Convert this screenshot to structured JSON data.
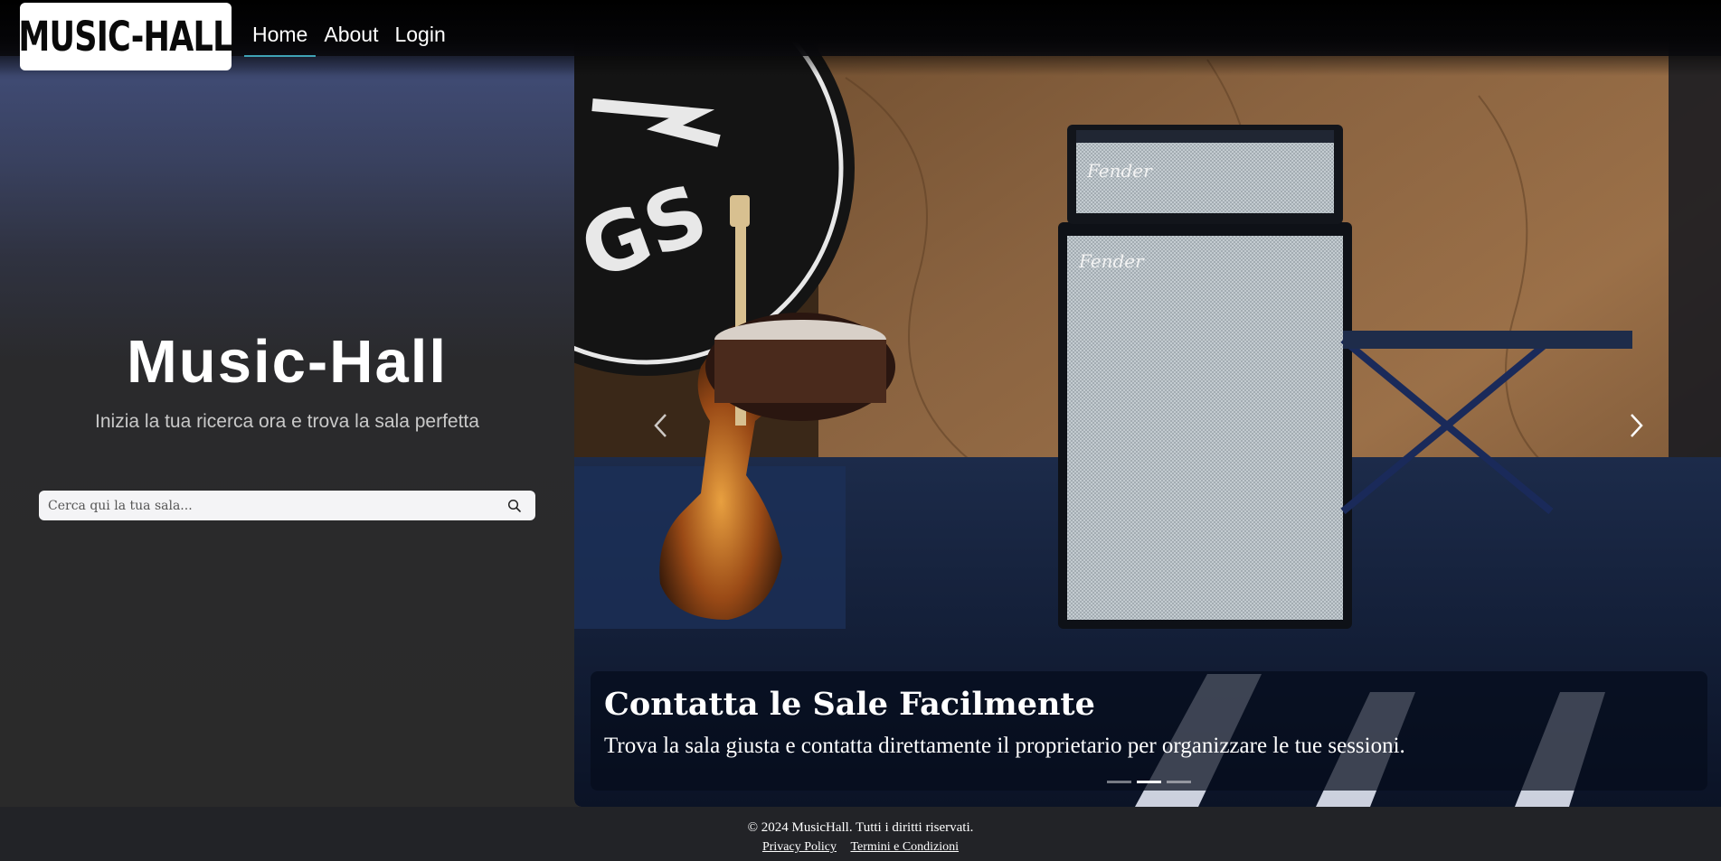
{
  "header": {
    "logo_text": "MUSIC-HALL",
    "nav": [
      {
        "label": "Home",
        "active": true
      },
      {
        "label": "About",
        "active": false
      },
      {
        "label": "Login",
        "active": false
      }
    ],
    "accent_color": "#3fa3b5"
  },
  "hero": {
    "title": "Music-Hall",
    "subtitle": "Inizia la tua ricerca ora e trova la sala perfetta",
    "search": {
      "placeholder": "Cerca qui la tua sala...",
      "value": "",
      "icon": "search-icon"
    }
  },
  "carousel": {
    "caption_title": "Contatta le Sale Facilmente",
    "caption_text": "Trova la sala giusta e contatta direttamente il proprietario per organizzare le tue sessioni.",
    "slide_count": 3,
    "active_index": 1,
    "prev_icon": "chevron-left-icon",
    "next_icon": "chevron-right-icon"
  },
  "footer": {
    "copyright": "© 2024 MusicHall. Tutti i diritti riservati.",
    "links": [
      "Privacy Policy",
      "Termini e Condizioni"
    ]
  }
}
